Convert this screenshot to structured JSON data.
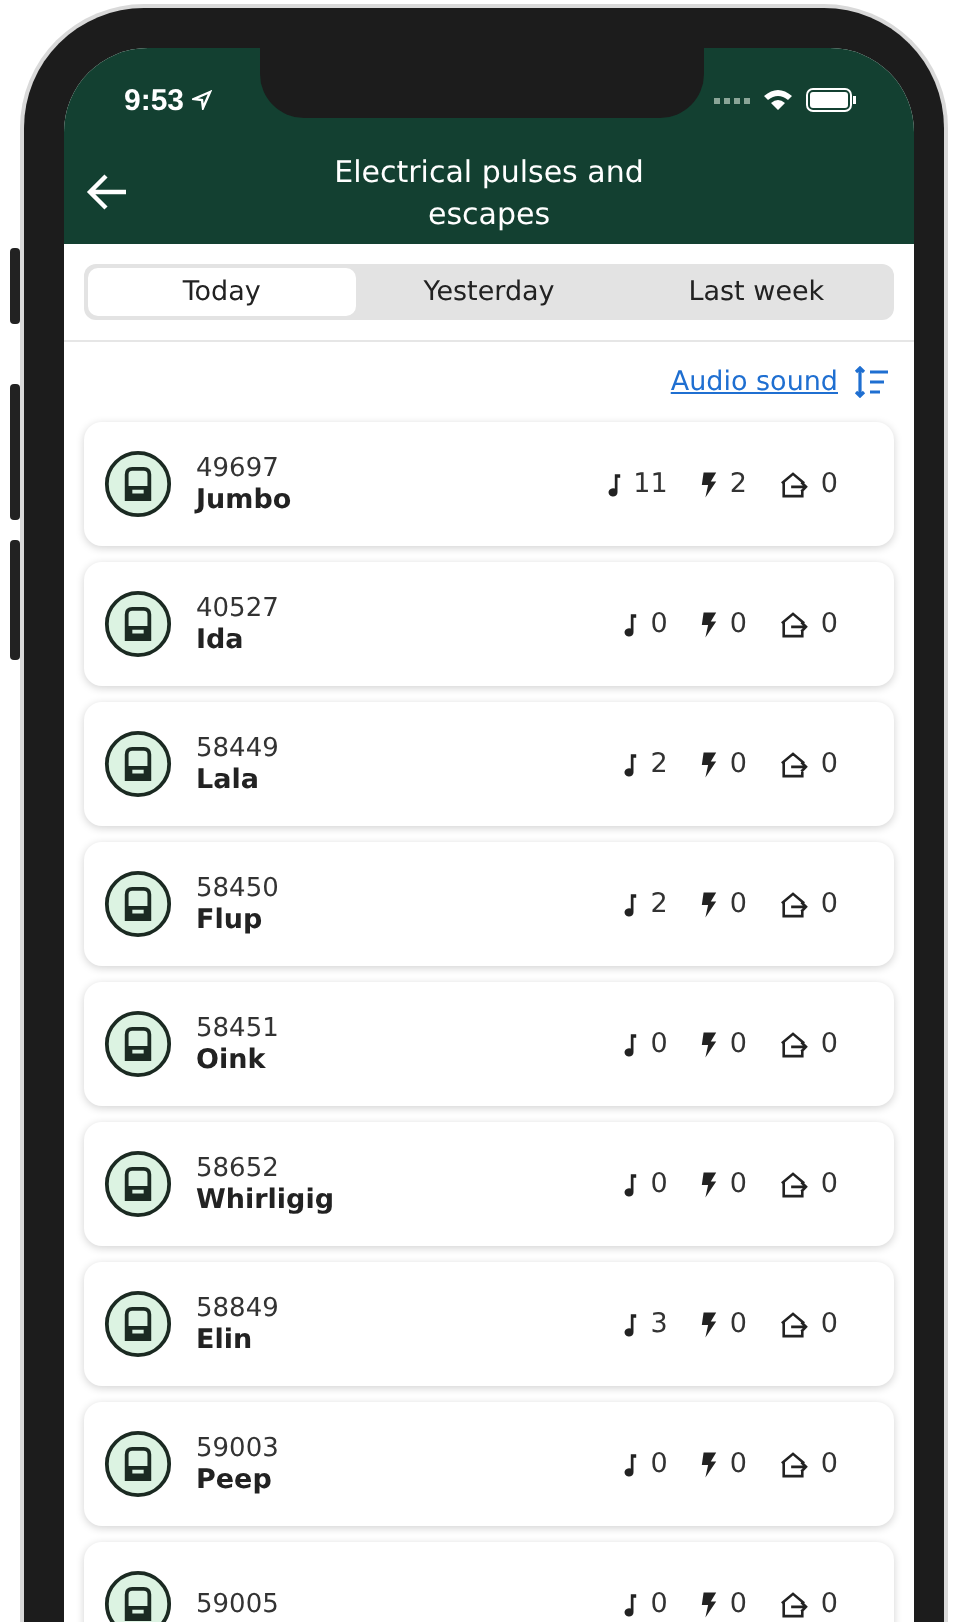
{
  "status_bar": {
    "time": "9:53"
  },
  "header": {
    "title": "Electrical pulses and escapes"
  },
  "tabs": [
    {
      "label": "Today",
      "selected": true
    },
    {
      "label": "Yesterday",
      "selected": false
    },
    {
      "label": "Last week",
      "selected": false
    }
  ],
  "sort": {
    "label": "Audio sound"
  },
  "animals": [
    {
      "id": "49697",
      "name": "Jumbo",
      "sounds": "11",
      "pulses": "2",
      "escapes": "0"
    },
    {
      "id": "40527",
      "name": "Ida",
      "sounds": "0",
      "pulses": "0",
      "escapes": "0"
    },
    {
      "id": "58449",
      "name": "Lala",
      "sounds": "2",
      "pulses": "0",
      "escapes": "0"
    },
    {
      "id": "58450",
      "name": "Flup",
      "sounds": "2",
      "pulses": "0",
      "escapes": "0"
    },
    {
      "id": "58451",
      "name": "Oink",
      "sounds": "0",
      "pulses": "0",
      "escapes": "0"
    },
    {
      "id": "58652",
      "name": "Whirligig",
      "sounds": "0",
      "pulses": "0",
      "escapes": "0"
    },
    {
      "id": "58849",
      "name": "Elin",
      "sounds": "3",
      "pulses": "0",
      "escapes": "0"
    },
    {
      "id": "59003",
      "name": "Peep",
      "sounds": "0",
      "pulses": "0",
      "escapes": "0"
    },
    {
      "id": "59005",
      "sounds": "0",
      "pulses": "0",
      "escapes": "0"
    }
  ]
}
